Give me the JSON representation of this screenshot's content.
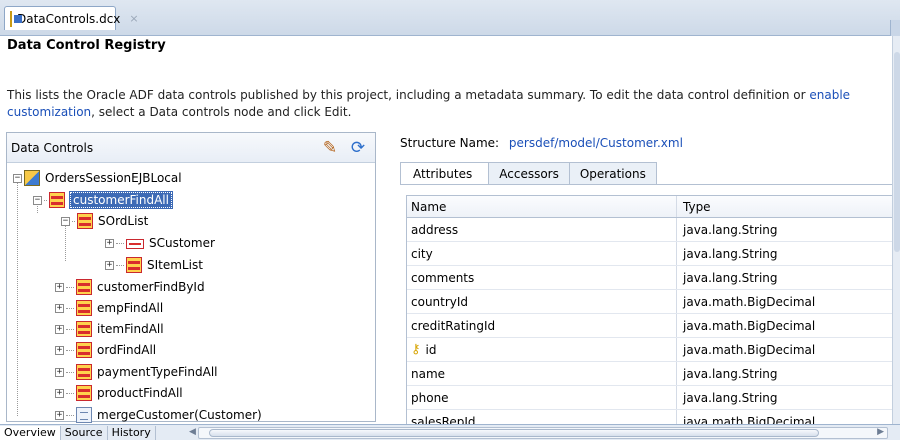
{
  "doc_tab": {
    "title": "DataControls.dcx",
    "close_glyph": "×"
  },
  "registry_title": "Data Control Registry",
  "description": {
    "text": "This lists the Oracle ADF data controls published by this project, including a metadata summary. To edit the data control definition or ",
    "link1": "enable customization",
    "text2": ", select a Data controls node and click Edit."
  },
  "left_panel": {
    "title": "Data Controls",
    "tree": [
      {
        "label": "OrdersSessionEJBLocal"
      },
      {
        "label": "customerFindAll"
      },
      {
        "label": "SOrdList"
      },
      {
        "label": "SCustomer"
      },
      {
        "label": "SItemList"
      },
      {
        "label": "customerFindById"
      },
      {
        "label": "empFindAll"
      },
      {
        "label": "itemFindAll"
      },
      {
        "label": "ordFindAll"
      },
      {
        "label": "paymentTypeFindAll"
      },
      {
        "label": "productFindAll"
      },
      {
        "label": "mergeCustomer(Customer)"
      }
    ]
  },
  "structure": {
    "label": "Structure Name:",
    "value": "persdef/model/Customer.xml"
  },
  "tabs": [
    {
      "label": "Attributes"
    },
    {
      "label": "Accessors"
    },
    {
      "label": "Operations"
    }
  ],
  "table": {
    "headers": {
      "name": "Name",
      "type": "Type"
    },
    "rows": [
      {
        "name": "address",
        "type": "java.lang.String"
      },
      {
        "name": "city",
        "type": "java.lang.String"
      },
      {
        "name": "comments",
        "type": "java.lang.String"
      },
      {
        "name": "countryId",
        "type": "java.math.BigDecimal"
      },
      {
        "name": "creditRatingId",
        "type": "java.math.BigDecimal"
      },
      {
        "name": "id",
        "type": "java.math.BigDecimal"
      },
      {
        "name": "name",
        "type": "java.lang.String"
      },
      {
        "name": "phone",
        "type": "java.lang.String"
      },
      {
        "name": "salesRepId",
        "type": "java.math.BigDecimal"
      }
    ]
  },
  "bottom_tabs": [
    {
      "label": "Overview"
    },
    {
      "label": "Source"
    },
    {
      "label": "History"
    }
  ],
  "colors": {
    "link": "#1a4fb8",
    "selection": "#3d6ab5"
  }
}
